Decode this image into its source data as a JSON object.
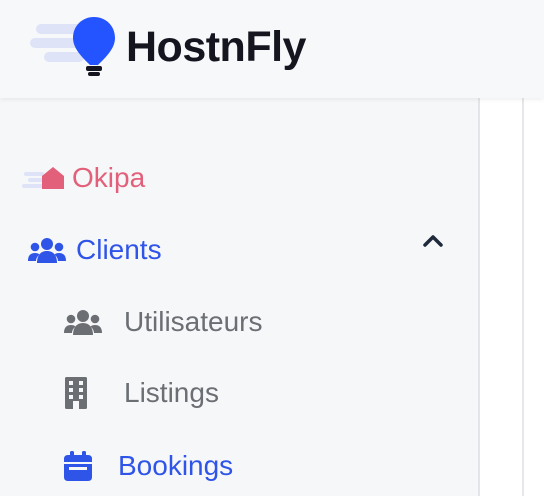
{
  "brand": {
    "name": "HostnFly",
    "logo_color": "#2454ff",
    "text_color": "#14151f"
  },
  "sidebar": {
    "items": [
      {
        "label": "Okipa",
        "icon": "okipa-house-icon",
        "color": "#e2607a"
      },
      {
        "label": "Clients",
        "icon": "users-icon",
        "color": "#2f54e8",
        "expanded": true,
        "toggle_icon": "chevron-up-icon"
      }
    ],
    "sub_items": [
      {
        "label": "Utilisateurs",
        "icon": "users-icon",
        "color": "#6b6e73"
      },
      {
        "label": "Listings",
        "icon": "building-icon",
        "color": "#6b6e73"
      },
      {
        "label": "Bookings",
        "icon": "calendar-icon",
        "color": "#2f54e8",
        "active": true
      }
    ]
  }
}
